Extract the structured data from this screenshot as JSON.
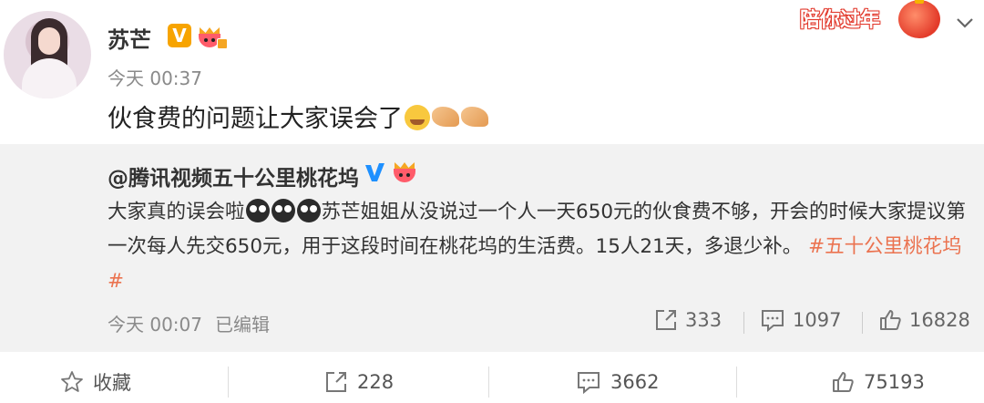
{
  "post": {
    "username": "苏芒",
    "verified_badge": "V",
    "timestamp": "今天 00:37",
    "text": "伙食费的问题让大家误会了",
    "emojis": [
      "crying-face-emoji",
      "praying-hands-emoji",
      "praying-hands-emoji"
    ]
  },
  "festival_banner": {
    "label": "陪你过年"
  },
  "repost": {
    "username": "@腾讯视频五十公里桃花坞",
    "text_part1": "大家真的误会啦",
    "text_part2": "苏芒姐姐从没说过一个人一天650元的伙食费不够，开会的时候大家提议第一次每人先交650元，用于这段时间在桃花坞的生活费。15人21天，多退少补。",
    "hashtag": "#五十公里桃花坞#",
    "timestamp": "今天 00:07",
    "edited": "已编辑",
    "reposts": "333",
    "comments": "1097",
    "likes": "16828"
  },
  "actions": {
    "favorite": "收藏",
    "reposts": "228",
    "comments": "3662",
    "likes": "75193"
  },
  "colors": {
    "accent": "#eb7350",
    "badge": "#f7a400",
    "repost_bg": "#f2f2f2"
  }
}
